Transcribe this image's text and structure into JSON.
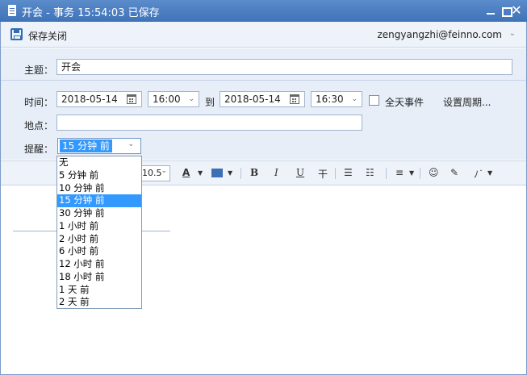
{
  "window": {
    "title": "开会 - 事务   15:54:03 已保存",
    "close_glyph": "✕"
  },
  "toolbar": {
    "save_label": "保存关闭",
    "account": "zengyangzhi@feinno.com",
    "account_chevron": "⌄"
  },
  "form": {
    "subject_label": "主题：",
    "subject_value": "开会",
    "time_label": "时间：",
    "start_date": "2018-05-14",
    "start_time": "16:00",
    "to_label": "到",
    "end_date": "2018-05-14",
    "end_time": "16:30",
    "all_day_label": "全天事件",
    "all_day_checked": false,
    "recurrence_label": "设置周期...",
    "location_label": "地点：",
    "location_value": "",
    "reminder_label": "提醒：",
    "reminder_value": "15 分钟 前"
  },
  "reminder_options": [
    "无",
    "5 分钟 前",
    "10 分钟 前",
    "15 分钟 前",
    "30 分钟 前",
    "1 小时 前",
    "2 小时 前",
    "6 小时 前",
    "12 小时 前",
    "18 小时 前",
    "1 天 前",
    "2 天 前"
  ],
  "reminder_selected_index": 3,
  "editor_toolbar": {
    "font_size": "10.5",
    "font_color_glyph": "A",
    "bold": "B",
    "italic": "I",
    "underline": "U",
    "strike": "干",
    "bullets": "☰",
    "numbering": "☷",
    "align": "≡",
    "emoji": "☺",
    "link": "✎",
    "magic": "ﾉ˙"
  }
}
